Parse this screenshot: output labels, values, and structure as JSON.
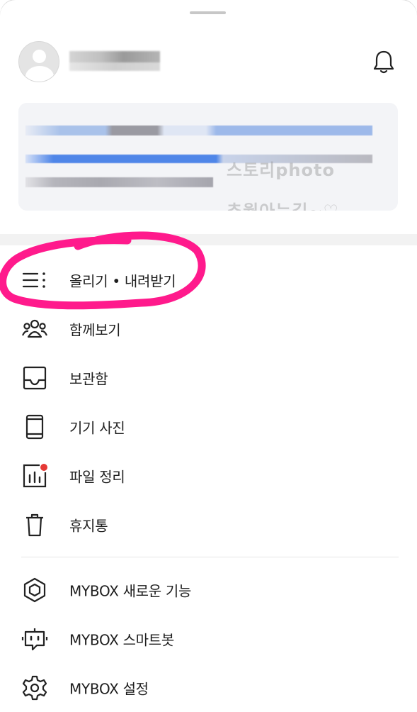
{
  "menu": {
    "items": [
      {
        "label": "올리기 • 내려받기",
        "icon": "list-menu-icon"
      },
      {
        "label": "함께보기",
        "icon": "people-icon"
      },
      {
        "label": "보관함",
        "icon": "inbox-tray-icon"
      },
      {
        "label": "기기 사진",
        "icon": "phone-device-icon"
      },
      {
        "label": "파일 정리",
        "icon": "chart-clean-icon"
      },
      {
        "label": "휴지통",
        "icon": "trash-icon"
      },
      {
        "label": "MYBOX 새로운 기능",
        "icon": "cube-icon"
      },
      {
        "label": "MYBOX 스마트봇",
        "icon": "robot-icon"
      },
      {
        "label": "MYBOX 설정",
        "icon": "gear-icon"
      }
    ]
  },
  "watermark": {
    "line1": "스토리photo",
    "line2": "추월아는길~♡"
  },
  "colors": {
    "accent": "#ff1a8c",
    "badge": "#e53935",
    "text": "#1e1e1e"
  }
}
